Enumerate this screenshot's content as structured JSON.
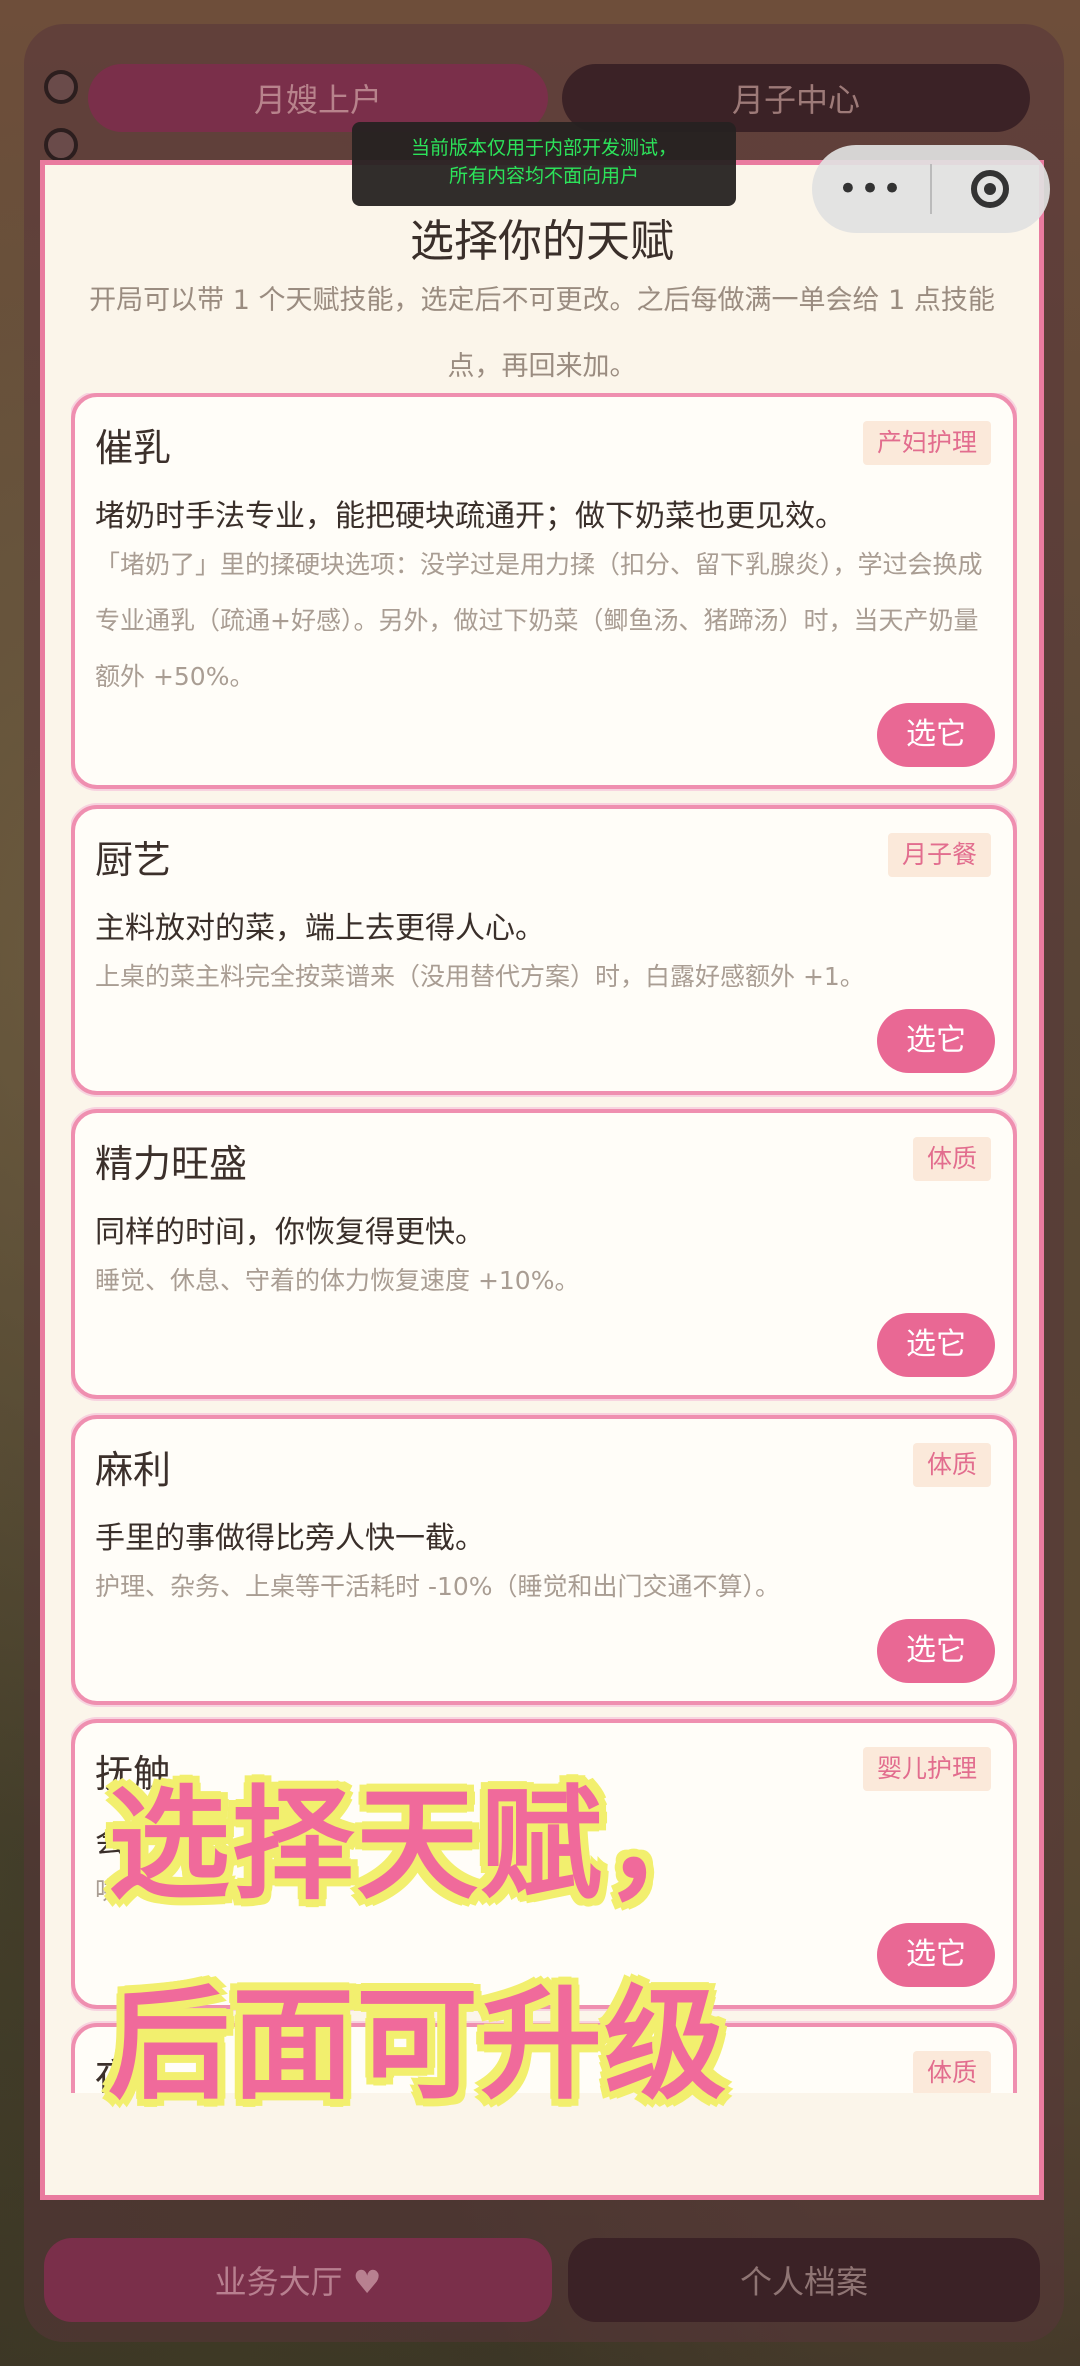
{
  "top_tabs": [
    {
      "label": "月嫂上户"
    },
    {
      "label": "月子中心"
    }
  ],
  "toast": {
    "line1": "当前版本仅用于内部开发测试，",
    "line2": "所有内容均不面向用户"
  },
  "capsule": {
    "more": "•••",
    "close_icon": "close-circle-icon"
  },
  "dialog": {
    "title": "选择你的天赋",
    "subtitle": "开局可以带 1 个天赋技能，选定后不可更改。之后每做满一单会给 1 点技能点，再回来加。",
    "select_label": "选它",
    "talents": [
      {
        "name": "催乳",
        "tag": "产妇护理",
        "summary": "堵奶时手法专业，能把硬块疏通开；做下奶菜也更见效。",
        "detail": "「堵奶了」里的揉硬块选项：没学过是用力揉（扣分、留下乳腺炎），学过会换成专业通乳（疏通+好感）。另外，做过下奶菜（鲫鱼汤、猪蹄汤）时，当天产奶量额外 +50%。"
      },
      {
        "name": "厨艺",
        "tag": "月子餐",
        "summary": "主料放对的菜，端上去更得人心。",
        "detail": "上桌的菜主料完全按菜谱来（没用替代方案）时，白露好感额外 +1。"
      },
      {
        "name": "精力旺盛",
        "tag": "体质",
        "summary": "同样的时间，你恢复得更快。",
        "detail": "睡觉、休息、守着的体力恢复速度 +10%。"
      },
      {
        "name": "麻利",
        "tag": "体质",
        "summary": "手里的事做得比旁人快一截。",
        "detail": "护理、杂务、上桌等干活耗时 -10%（睡觉和出门交通不算）。"
      },
      {
        "name": "抚触",
        "tag": "婴儿护理",
        "summary": "会",
        "detail": "哄"
      },
      {
        "name": "夜",
        "tag": "体质",
        "summary": "",
        "detail": ""
      }
    ]
  },
  "overlay": {
    "line1": "选择天赋，",
    "line2": "后面可升级"
  },
  "bottom_tabs": [
    {
      "label": "业务大厅 ♥"
    },
    {
      "label": "个人档案"
    }
  ]
}
